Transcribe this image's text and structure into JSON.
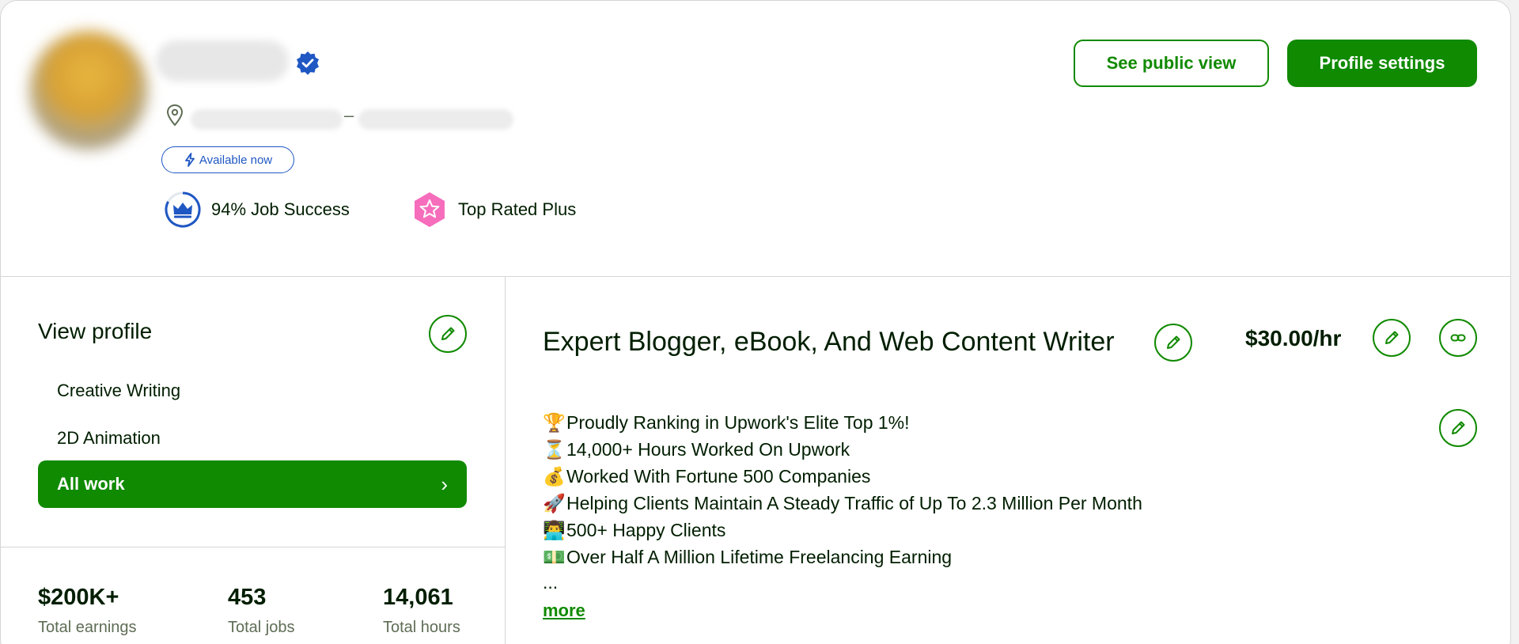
{
  "header": {
    "available_label": "Available now",
    "job_success_label": "94% Job Success",
    "top_rated_label": "Top Rated Plus",
    "location_separator": "–",
    "buttons": {
      "public_view": "See public view",
      "settings": "Profile settings"
    }
  },
  "sidebar": {
    "title": "View profile",
    "items": [
      {
        "label": "Creative Writing"
      },
      {
        "label": "2D Animation"
      }
    ],
    "active_item": {
      "label": "All work",
      "chevron": "›"
    }
  },
  "stats": [
    {
      "value": "$200K+",
      "label": "Total earnings"
    },
    {
      "value": "453",
      "label": "Total jobs"
    },
    {
      "value": "14,061",
      "label": "Total hours"
    }
  ],
  "profile": {
    "title": "Expert Blogger, eBook, And Web Content Writer",
    "rate": "$30.00/hr",
    "description": [
      {
        "emoji": "🏆",
        "text": "Proudly Ranking in Upwork's Elite Top 1%!"
      },
      {
        "emoji": "⏳",
        "text": "14,000+ Hours Worked On Upwork"
      },
      {
        "emoji": "💰",
        "text": "Worked With Fortune 500 Companies"
      },
      {
        "emoji": "🚀",
        "text": "Helping Clients Maintain A Steady Traffic of Up To 2.3 Million Per Month"
      },
      {
        "emoji": "👨‍💻",
        "text": "500+ Happy Clients"
      },
      {
        "emoji": "💵",
        "text": "Over Half A Million Lifetime Freelancing Earning"
      }
    ],
    "ellipsis": "...",
    "more_label": "more"
  },
  "colors": {
    "brand_green": "#108a00",
    "verified_blue": "#1f57c3",
    "top_rated_pink": "#f66dbc",
    "text": "#001e00",
    "muted": "#5e6d55"
  },
  "icons": {
    "verified": "verified-badge-icon",
    "location": "location-pin-icon",
    "available": "lightning-bolt-icon",
    "job_success": "crown-icon",
    "top_rated": "star-badge-icon",
    "edit": "pencil-icon",
    "link": "link-icon",
    "chevron": "chevron-right-icon"
  }
}
